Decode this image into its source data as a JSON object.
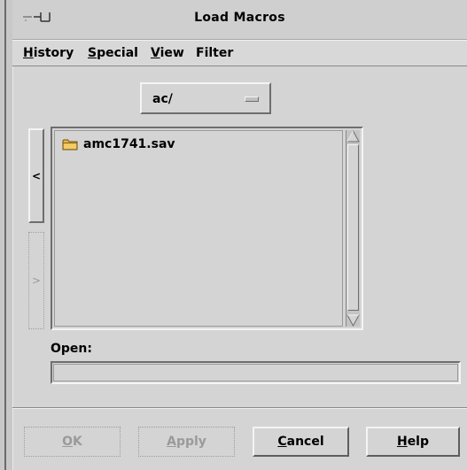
{
  "window": {
    "title": "Load Macros"
  },
  "menubar": {
    "items": [
      {
        "mnemonic": "H",
        "rest": "istory"
      },
      {
        "mnemonic": "S",
        "rest": "pecial"
      },
      {
        "mnemonic": "V",
        "rest": "iew"
      },
      {
        "mnemonic": "",
        "rest": "Filter"
      }
    ]
  },
  "directory": {
    "selected": "ac/"
  },
  "nav": {
    "back_label": "<",
    "forward_label": ">"
  },
  "file_list": {
    "items": [
      {
        "name": "amc1741.sav",
        "icon": "folder-icon"
      }
    ]
  },
  "open": {
    "label": "Open:",
    "value": ""
  },
  "buttons": {
    "ok": {
      "mnemonic": "O",
      "rest": "K",
      "enabled": false
    },
    "apply": {
      "mnemonic": "A",
      "rest": "pply",
      "enabled": false
    },
    "cancel": {
      "mnemonic": "C",
      "rest": "ancel",
      "enabled": true
    },
    "help": {
      "mnemonic": "H",
      "rest": "elp",
      "enabled": true
    }
  },
  "colors": {
    "background": "#d4d4d4",
    "folder": "#e8b84a"
  }
}
